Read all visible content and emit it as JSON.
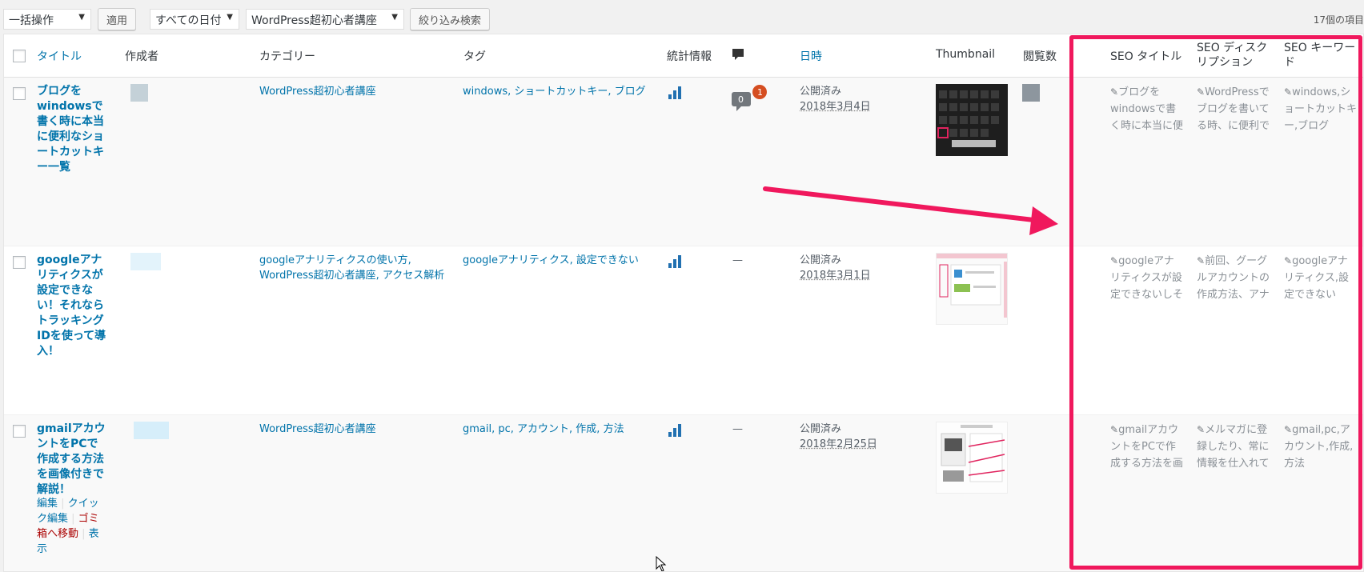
{
  "toolbar": {
    "bulk_action": "一括操作",
    "apply_label": "適用",
    "date_filter": "すべての日付",
    "category_filter": "WordPress超初心者講座",
    "filter_label": "絞り込み検索",
    "item_count": "17個の項目"
  },
  "columns": {
    "title": "タイトル",
    "author": "作成者",
    "categories": "カテゴリー",
    "tags": "タグ",
    "stats": "統計情報",
    "date": "日時",
    "thumbnail": "Thumbnail",
    "views": "閲覧数",
    "seo_title": "SEO タイトル",
    "seo_description": "SEO ディスクリプション",
    "seo_keywords": "SEO キーワード"
  },
  "rows": [
    {
      "title": "ブログをwindowsで書く時に本当に便利なショートカットキー一覧",
      "categories": "WordPress超初心者講座",
      "tags": "windows, ショートカットキー, ブログ",
      "comments": "0",
      "pending": "1",
      "status": "公開済み",
      "date": "2018年3月4日",
      "seo_title": "ブログをwindowsで書く時に本当に便利なショ",
      "seo_description": "WordPressでブログを書いてる時、に便利で覚え",
      "seo_keywords": "windows,ショートカットキー,ブログ"
    },
    {
      "title": "googleアナリティクスが設定できない！それならトラッキングIDを使って導入！",
      "categories": "googleアナリティクスの使い方, WordPress超初心者講座, アクセス解析",
      "tags": "googleアナリティクス, 設定できない",
      "comments": "—",
      "status": "公開済み",
      "date": "2018年3月1日",
      "seo_title": "googleアナリティクスが設定できないしそれなら",
      "seo_description": "前回、グーグルアカウントの作成方法、アナリテ",
      "seo_keywords": "googleアナリティクス,設定できない"
    },
    {
      "title": "gmailアカウントをPCで作成する方法を画像付きで解説！",
      "categories": "WordPress超初心者講座",
      "tags": "gmail, pc, アカウント, 作成, 方法",
      "comments": "—",
      "status": "公開済み",
      "date": "2018年2月25日",
      "seo_title": "gmailアカウントをPCで作成する方法を画像付きで",
      "seo_description": "メルマガに登録したり、常に情報を仕入れておきた",
      "seo_keywords": "gmail,pc,アカウント,作成,方法",
      "actions": {
        "edit": "編集",
        "quick_edit": "クイック編集",
        "trash": "ゴミ箱へ移動",
        "view": "表示"
      }
    }
  ],
  "colors": {
    "accent": "#0073aa",
    "highlight": "#f0185d",
    "bubble_pending": "#d54e21"
  }
}
